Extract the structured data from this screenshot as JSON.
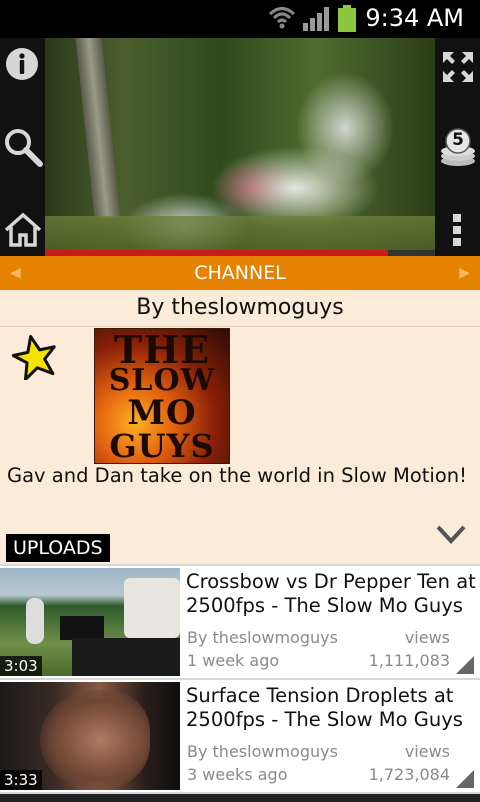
{
  "status_bar": {
    "time": "9:34 AM",
    "wifi_icon": "wifi-icon",
    "signal_icon": "signal-icon",
    "battery_icon": "battery-icon",
    "battery_color": "#8dc63f"
  },
  "player": {
    "progress": 0.88,
    "progress_color": "#cc1a1a",
    "icons": {
      "info": "info-icon",
      "search": "search-icon",
      "home": "home-icon",
      "fullscreen": "fullscreen-icon",
      "queue": "queue-icon",
      "menu": "overflow-menu-icon"
    },
    "queue_count": "5"
  },
  "channel_bar": {
    "label": "CHANNEL",
    "accent": "#e58200"
  },
  "channel": {
    "byline": "By theslowmoguys",
    "logo_lines": [
      "THE",
      "SLOW",
      "MO",
      "GUYS"
    ],
    "description": "Gav and Dan take on the world in Slow Motion!",
    "star_icon": "favorite-star-icon"
  },
  "uploads": {
    "label": "UPLOADS",
    "items": [
      {
        "title": "Crossbow vs Dr Pepper Ten at 2500fps - The Slow Mo Guys",
        "by": "By theslowmoguys",
        "age": "1 week ago",
        "views_label": "views",
        "views": "1,111,083",
        "duration": "3:03"
      },
      {
        "title": "Surface Tension Droplets at 2500fps - The Slow Mo Guys",
        "by": "By theslowmoguys",
        "age": "3 weeks ago",
        "views_label": "views",
        "views": "1,723,084",
        "duration": "3:33"
      }
    ]
  }
}
